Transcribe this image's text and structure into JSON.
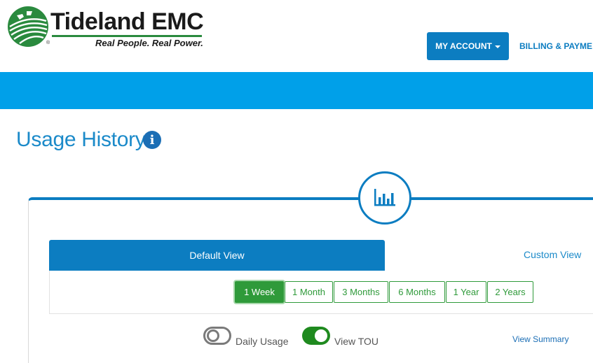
{
  "brand": {
    "name": "Tideland EMC",
    "tagline": "Real People. Real Power.",
    "reg_mark": "®",
    "primary_color": "#0c7dc1",
    "band_color": "#00a0e9",
    "green_color": "#2f9a3a"
  },
  "nav": {
    "account_label": "MY ACCOUNT",
    "billing_label": "BILLING & PAYME"
  },
  "page": {
    "title": "Usage History",
    "info_glyph": "i"
  },
  "views": {
    "default_label": "Default View",
    "custom_label": "Custom View"
  },
  "ranges": [
    {
      "label": "1 Week",
      "active": true
    },
    {
      "label": "1 Month",
      "active": false
    },
    {
      "label": "3 Months",
      "active": false
    },
    {
      "label": "6 Months",
      "active": false
    },
    {
      "label": "1 Year",
      "active": false
    },
    {
      "label": "2 Years",
      "active": false
    }
  ],
  "toggles": {
    "daily_usage": {
      "label": "Daily Usage",
      "on": false
    },
    "view_tou": {
      "label": "View TOU",
      "on": true
    }
  },
  "summary_link": "View Summary",
  "icons": {
    "chart": "bar-chart-icon",
    "info": "info-icon",
    "caret": "caret-down-icon"
  }
}
